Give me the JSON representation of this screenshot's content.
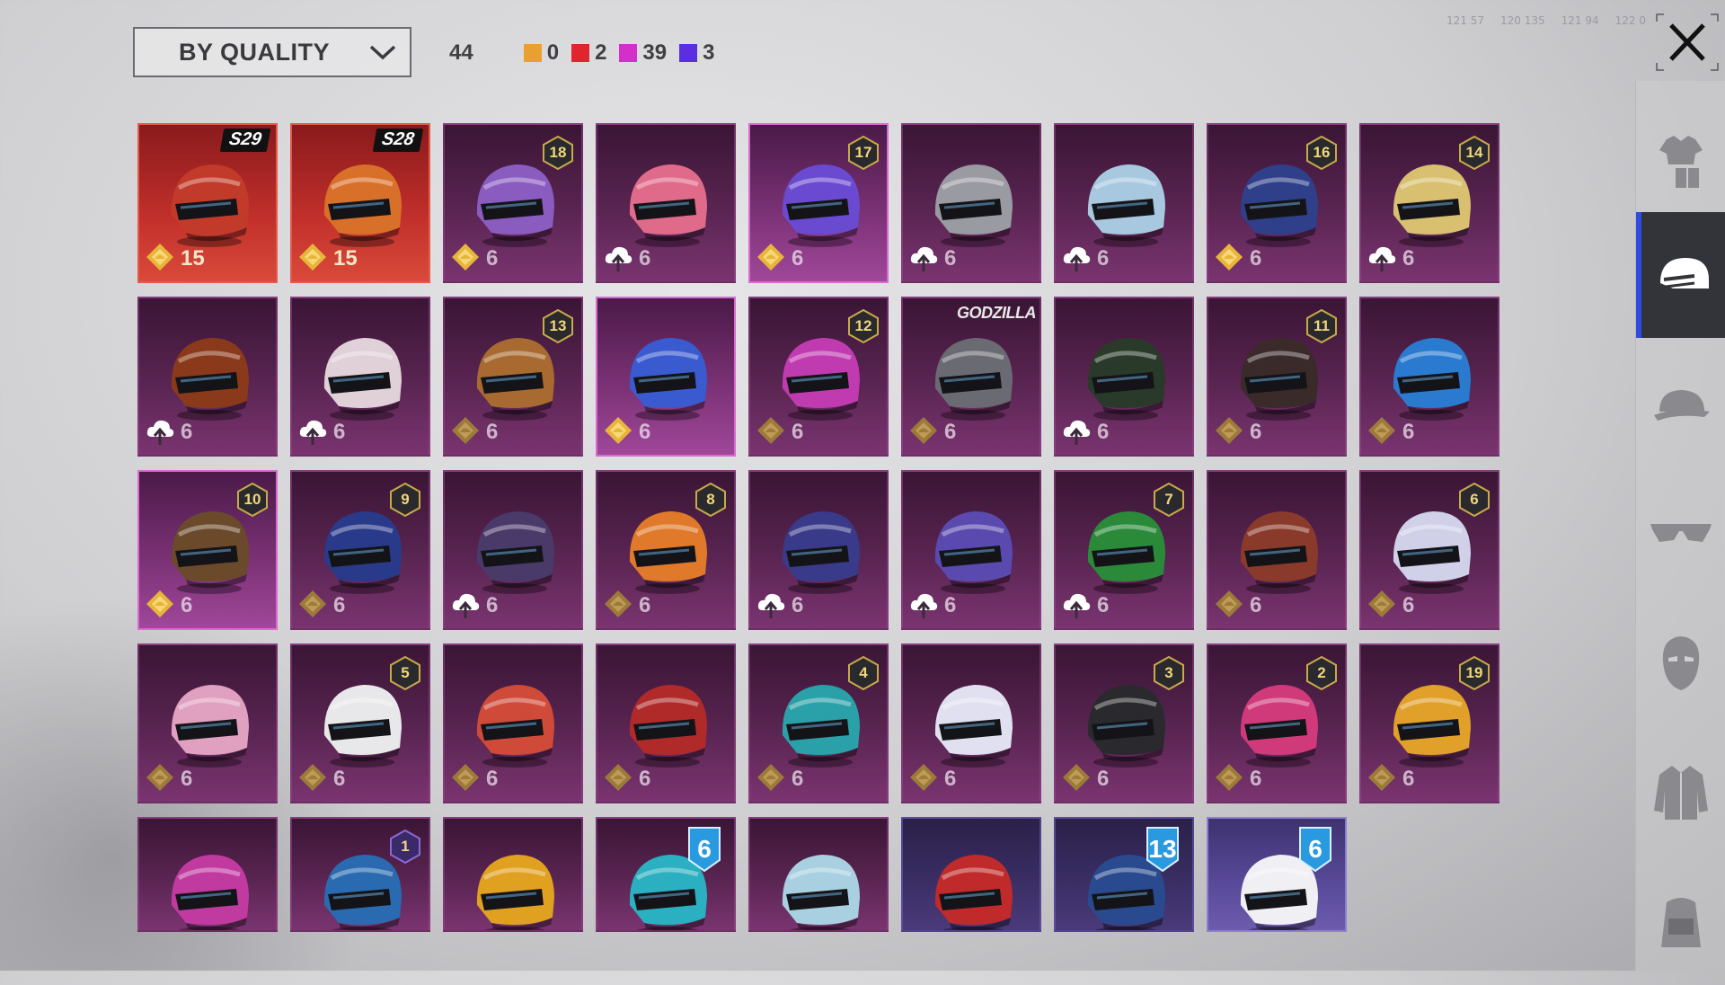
{
  "sort": {
    "label": "BY QUALITY"
  },
  "counts": {
    "total": "44",
    "by_quality": [
      {
        "color": "#e8a131",
        "count": "0"
      },
      {
        "color": "#e0252e",
        "count": "2"
      },
      {
        "color": "#d42fc9",
        "count": "39"
      },
      {
        "color": "#5b2ee0",
        "count": "3"
      }
    ]
  },
  "status": {
    "items": [
      "121 57",
      "120 135",
      "121 94",
      "122 0"
    ]
  },
  "colors": {
    "accent": "#2f4be0",
    "legendary": "#d9423a",
    "mythic": "#7a3174",
    "epic": "#4b3a7a"
  },
  "sidebar": {
    "items": [
      {
        "name": "outfit",
        "icon": "outfit-icon",
        "active": false
      },
      {
        "name": "helmet",
        "icon": "helmet-icon",
        "active": true
      },
      {
        "name": "hat",
        "icon": "cap-icon",
        "active": false
      },
      {
        "name": "glasses",
        "icon": "glasses-icon",
        "active": false
      },
      {
        "name": "mask",
        "icon": "mask-icon",
        "active": false
      },
      {
        "name": "jacket",
        "icon": "jacket-icon",
        "active": false
      },
      {
        "name": "backpack",
        "icon": "backpack-icon",
        "active": false
      }
    ]
  },
  "items": [
    {
      "quality": "legend",
      "tag": "S29",
      "tag_type": "season",
      "icon": "gold-badge",
      "count": "15",
      "hue": "#c23a2a"
    },
    {
      "quality": "legend",
      "tag": "S28",
      "tag_type": "season",
      "icon": "gold-badge",
      "count": "15",
      "hue": "#d9702a"
    },
    {
      "quality": "mythic",
      "tag": "18",
      "tag_type": "level",
      "icon": "gold-badge",
      "count": "6",
      "hue": "#8a5cc0"
    },
    {
      "quality": "mythic",
      "tag": "",
      "tag_type": "",
      "icon": "cloud-upgrade",
      "count": "6",
      "hue": "#e06a8a"
    },
    {
      "quality": "mythic-hl",
      "tag": "17",
      "tag_type": "level",
      "icon": "gold-badge",
      "count": "6",
      "hue": "#6a4ad0"
    },
    {
      "quality": "mythic",
      "tag": "",
      "tag_type": "",
      "icon": "cloud-upgrade",
      "count": "6",
      "hue": "#9a9aa2"
    },
    {
      "quality": "mythic",
      "tag": "",
      "tag_type": "",
      "icon": "cloud-upgrade",
      "count": "6",
      "hue": "#a8c8e0"
    },
    {
      "quality": "mythic",
      "tag": "16",
      "tag_type": "level",
      "icon": "gold-badge",
      "count": "6",
      "hue": "#2f3f8a"
    },
    {
      "quality": "mythic",
      "tag": "14",
      "tag_type": "level",
      "icon": "cloud-upgrade",
      "count": "6",
      "hue": "#d8c070"
    },
    {
      "quality": "mythic",
      "tag": "",
      "tag_type": "",
      "icon": "cloud-upgrade",
      "count": "6",
      "hue": "#8a3a1a"
    },
    {
      "quality": "mythic",
      "tag": "",
      "tag_type": "",
      "icon": "cloud-upgrade",
      "count": "6",
      "hue": "#e0d0d8"
    },
    {
      "quality": "mythic",
      "tag": "13",
      "tag_type": "level",
      "icon": "bronze-badge",
      "count": "6",
      "hue": "#a86a30"
    },
    {
      "quality": "mythic-hl",
      "tag": "",
      "tag_type": "",
      "icon": "gold-badge",
      "count": "6",
      "hue": "#3a5ad0"
    },
    {
      "quality": "mythic",
      "tag": "12",
      "tag_type": "level",
      "icon": "bronze-badge",
      "count": "6",
      "hue": "#c03ab0"
    },
    {
      "quality": "mythic",
      "tag": "GODZILLA",
      "tag_type": "brand",
      "icon": "bronze-badge",
      "count": "6",
      "hue": "#6a6a72"
    },
    {
      "quality": "mythic",
      "tag": "",
      "tag_type": "",
      "icon": "cloud-upgrade",
      "count": "6",
      "hue": "#2a3a2a"
    },
    {
      "quality": "mythic",
      "tag": "11",
      "tag_type": "level",
      "icon": "bronze-badge",
      "count": "6",
      "hue": "#3a2a2a"
    },
    {
      "quality": "mythic",
      "tag": "",
      "tag_type": "",
      "icon": "bronze-badge",
      "count": "6",
      "hue": "#2a7ad0"
    },
    {
      "quality": "mythic-hl",
      "tag": "10",
      "tag_type": "level",
      "icon": "gold-badge",
      "count": "6",
      "hue": "#6a4a2a"
    },
    {
      "quality": "mythic",
      "tag": "9",
      "tag_type": "level",
      "icon": "bronze-badge",
      "count": "6",
      "hue": "#2a3a8a"
    },
    {
      "quality": "mythic",
      "tag": "",
      "tag_type": "",
      "icon": "cloud-upgrade",
      "count": "6",
      "hue": "#4a3a6a"
    },
    {
      "quality": "mythic",
      "tag": "8",
      "tag_type": "level",
      "icon": "bronze-badge",
      "count": "6",
      "hue": "#e07a2a"
    },
    {
      "quality": "mythic",
      "tag": "",
      "tag_type": "",
      "icon": "cloud-upgrade",
      "count": "6",
      "hue": "#3a3a8a"
    },
    {
      "quality": "mythic",
      "tag": "",
      "tag_type": "",
      "icon": "cloud-upgrade",
      "count": "6",
      "hue": "#5a4ab0"
    },
    {
      "quality": "mythic",
      "tag": "7",
      "tag_type": "level",
      "icon": "cloud-upgrade",
      "count": "6",
      "hue": "#2a8a3a"
    },
    {
      "quality": "mythic",
      "tag": "",
      "tag_type": "",
      "icon": "bronze-badge",
      "count": "6",
      "hue": "#8a3a2a"
    },
    {
      "quality": "mythic",
      "tag": "6",
      "tag_type": "level",
      "icon": "bronze-badge",
      "count": "6",
      "hue": "#d0d0e8"
    },
    {
      "quality": "mythic",
      "tag": "",
      "tag_type": "",
      "icon": "bronze-badge",
      "count": "6",
      "hue": "#e0a0c0"
    },
    {
      "quality": "mythic",
      "tag": "5",
      "tag_type": "level",
      "icon": "bronze-badge",
      "count": "6",
      "hue": "#e8e8ea"
    },
    {
      "quality": "mythic",
      "tag": "",
      "tag_type": "",
      "icon": "bronze-badge",
      "count": "6",
      "hue": "#d04a3a"
    },
    {
      "quality": "mythic",
      "tag": "",
      "tag_type": "",
      "icon": "bronze-badge",
      "count": "6",
      "hue": "#b02a2a"
    },
    {
      "quality": "mythic",
      "tag": "4",
      "tag_type": "level",
      "icon": "bronze-badge",
      "count": "6",
      "hue": "#2aa0a8"
    },
    {
      "quality": "mythic",
      "tag": "",
      "tag_type": "",
      "icon": "bronze-badge",
      "count": "6",
      "hue": "#e0e0f0"
    },
    {
      "quality": "mythic",
      "tag": "3",
      "tag_type": "level",
      "icon": "bronze-badge",
      "count": "6",
      "hue": "#2a2a2e"
    },
    {
      "quality": "mythic",
      "tag": "2",
      "tag_type": "level",
      "icon": "bronze-badge",
      "count": "6",
      "hue": "#d03a7a"
    },
    {
      "quality": "mythic",
      "tag": "19",
      "tag_type": "level",
      "icon": "bronze-badge",
      "count": "6",
      "hue": "#e0a02a"
    },
    {
      "quality": "mythic",
      "tag": "",
      "tag_type": "",
      "icon": "",
      "count": "",
      "hue": "#c03aa0"
    },
    {
      "quality": "mythic",
      "tag": "1",
      "tag_type": "level-purple",
      "icon": "",
      "count": "",
      "hue": "#2a6ab0"
    },
    {
      "quality": "mythic",
      "tag": "",
      "tag_type": "",
      "icon": "",
      "count": "",
      "hue": "#e0a020"
    },
    {
      "quality": "mythic",
      "tag": "6",
      "tag_type": "big",
      "icon": "",
      "count": "",
      "hue": "#2ab0c0"
    },
    {
      "quality": "mythic",
      "tag": "",
      "tag_type": "",
      "icon": "",
      "count": "",
      "hue": "#a8d0e0"
    },
    {
      "quality": "purple",
      "tag": "",
      "tag_type": "",
      "icon": "",
      "count": "",
      "hue": "#c02a2a"
    },
    {
      "quality": "purple",
      "tag": "13",
      "tag_type": "big",
      "icon": "",
      "count": "",
      "hue": "#2a4a90"
    },
    {
      "quality": "lav",
      "tag": "6",
      "tag_type": "big",
      "icon": "",
      "count": "",
      "hue": "#f0f0f4"
    }
  ]
}
